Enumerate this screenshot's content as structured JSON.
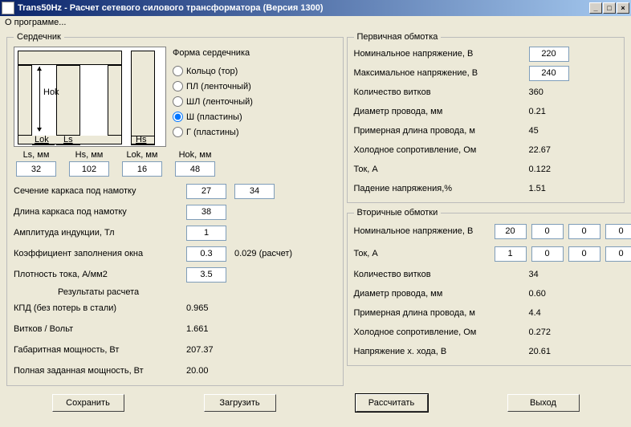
{
  "window": {
    "title": "Trans50Hz - Расчет сетевого силового трансформатора (Версия 1300)"
  },
  "menu": {
    "about": "О программе..."
  },
  "core": {
    "legend": "Сердечник",
    "shape_title": "Форма сердечника",
    "shapes": {
      "ring": "Кольцо (тор)",
      "pl": "ПЛ (ленточный)",
      "shl": "ШЛ (ленточный)",
      "sh": "Ш (пластины)",
      "g": "Г (пластины)"
    },
    "diagram": {
      "hok": "Hok",
      "lok": "Lok",
      "ls": "Ls",
      "hs": "Hs"
    },
    "dims": {
      "ls": {
        "label": "Ls, мм",
        "value": "32"
      },
      "hs": {
        "label": "Hs, мм",
        "value": "102"
      },
      "lok": {
        "label": "Lok, мм",
        "value": "16"
      },
      "hok": {
        "label": "Hok, мм",
        "value": "48"
      }
    },
    "params": {
      "carcass_section": {
        "label": "Сечение каркаса под намотку",
        "v1": "27",
        "v2": "34"
      },
      "carcass_length": {
        "label": "Длина каркаса под намотку",
        "v": "38"
      },
      "b_amp": {
        "label": "Амплитуда индукции, Тл",
        "v": "1"
      },
      "fill_factor": {
        "label": "Коэффициент заполнения окна",
        "v": "0.3",
        "extra": "0.029 (расчет)"
      },
      "j_density": {
        "label": "Плотность тока, А/мм2",
        "v": "3.5"
      }
    },
    "results_header": "Результаты расчета",
    "results": {
      "kpd": {
        "label": "КПД (без потерь в стали)",
        "v": "0.965"
      },
      "vpv": {
        "label": "Витков / Вольт",
        "v": "1.661"
      },
      "gab_pow": {
        "label": "Габаритная мощность, Вт",
        "v": "207.37"
      },
      "full_pow": {
        "label": "Полная заданная мощность, Вт",
        "v": "20.00"
      }
    }
  },
  "primary": {
    "legend": "Первичная обмотка",
    "rows": {
      "u_nom": {
        "label": "Номинальное напряжение, В",
        "v": "220",
        "input": true
      },
      "u_max": {
        "label": "Максимальное напряжение, В",
        "v": "240",
        "input": true
      },
      "turns": {
        "label": "Количество витков",
        "v": "360"
      },
      "d_wire": {
        "label": "Диаметр провода, мм",
        "v": "0.21"
      },
      "len": {
        "label": "Примерная длина провода, м",
        "v": "45"
      },
      "r_cold": {
        "label": "Холодное сопротивление, Ом",
        "v": "22.67"
      },
      "i": {
        "label": "Ток, А",
        "v": "0.122"
      },
      "dv": {
        "label": "Падение напряжения,%",
        "v": "1.51"
      }
    }
  },
  "secondary": {
    "legend": "Вторичные обмотки",
    "rows": {
      "u_nom": {
        "label": "Номинальное напряжение, В",
        "vals": [
          "20",
          "0",
          "0",
          "0"
        ],
        "inputs": true
      },
      "i": {
        "label": "Ток, А",
        "vals": [
          "1",
          "0",
          "0",
          "0"
        ],
        "inputs": true
      },
      "turns": {
        "label": "Количество витков",
        "v": "34"
      },
      "d_wire": {
        "label": "Диаметр провода, мм",
        "v": "0.60"
      },
      "len": {
        "label": "Примерная длина провода, м",
        "v": "4.4"
      },
      "r_cold": {
        "label": "Холодное сопротивление, Ом",
        "v": "0.272"
      },
      "u_xx": {
        "label": "Напряжение х. хода, В",
        "v": "20.61"
      }
    }
  },
  "buttons": {
    "save": "Сохранить",
    "load": "Загрузить",
    "calc": "Рассчитать",
    "exit": "Выход"
  }
}
